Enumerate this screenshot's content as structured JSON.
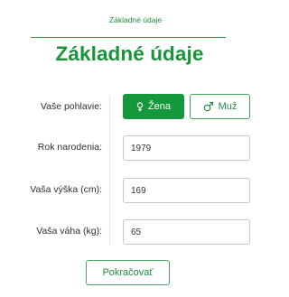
{
  "step": {
    "label": "Základné údaje"
  },
  "page": {
    "title": "Základné údaje"
  },
  "form": {
    "gender": {
      "label": "Vaše pohlavie:",
      "options": [
        {
          "label": "Žena",
          "icon": "female-symbol-icon",
          "selected": true
        },
        {
          "label": "Muž",
          "icon": "male-symbol-icon",
          "selected": false
        }
      ]
    },
    "birth_year": {
      "label": "Rok narodenia:",
      "value": "1979"
    },
    "height": {
      "label": "Vaša výška (cm):",
      "value": "169"
    },
    "weight": {
      "label": "Vaša váha (kg):",
      "value": "65"
    }
  },
  "actions": {
    "continue_label": "Pokračovať"
  },
  "colors": {
    "accent": "#15973b",
    "text": "#2f2f2f",
    "border": "#c7c7c7"
  }
}
